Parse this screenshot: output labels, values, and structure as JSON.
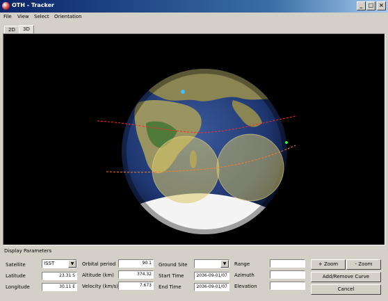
{
  "window": {
    "title": "OTH - Tracker",
    "minimize": "_",
    "maximize": "□",
    "close": "×"
  },
  "menu": [
    "File",
    "View",
    "Select",
    "Orientation"
  ],
  "tabs": [
    {
      "label": "2D",
      "active": false
    },
    {
      "label": "3D",
      "active": true
    }
  ],
  "colors": {
    "ocean": "#23407a",
    "coverage": "#c8b85a",
    "orbit": "#ff2a2a",
    "ice": "#f4f4f4"
  },
  "panel": {
    "title": "Display Parameters",
    "satellite_label": "Satellite",
    "satellite_value": "ISST",
    "latitude_label": "Latitude",
    "latitude_value": "23.31 S",
    "longitude_label": "Longitude",
    "longitude_value": "30.11 E",
    "orbital_period_label": "Orbital period",
    "orbital_period_value": "90.1",
    "altitude_label": "Altitude (km)",
    "altitude_value": "374.32",
    "velocity_label": "Velocity (km/s)",
    "velocity_value": "7.673",
    "ground_site_label": "Ground Site",
    "ground_site_value": "",
    "start_time_label": "Start Time",
    "start_time_value": "2036-09-01/07",
    "end_time_label": "End Time",
    "end_time_value": "2036-09-01/07",
    "range_label": "Range",
    "range_value": "",
    "azimuth_label": "Azimuth",
    "azimuth_value": "",
    "elevation_label": "Elevation",
    "elevation_value": "",
    "zoom_in": "+ Zoom",
    "zoom_out": "- Zoom",
    "add_remove_curve": "Add/Remove Curve",
    "cancel": "Cancel"
  }
}
